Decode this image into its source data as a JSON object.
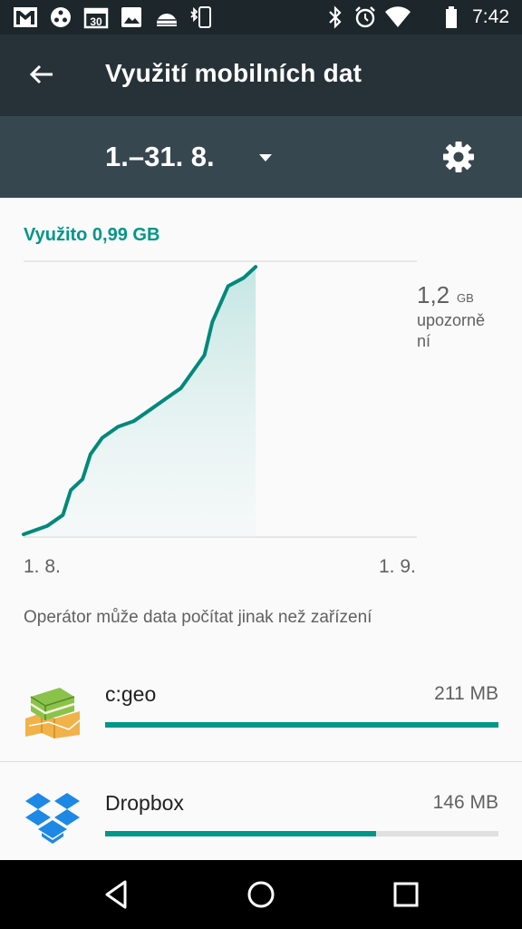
{
  "status_bar": {
    "time": "7:42",
    "calendar_day": "30",
    "left_icons": [
      "gmail-icon",
      "share-icon",
      "calendar-icon",
      "image-icon",
      "android-icon",
      "bluetooth-phone-icon"
    ],
    "right_icons": [
      "bluetooth-icon",
      "alarm-icon",
      "wifi-icon",
      "battery-icon"
    ]
  },
  "app_bar": {
    "title": "Využití mobilních dat",
    "back_icon": "arrow-back-icon"
  },
  "cycle": {
    "label": "1.–31. 8.",
    "dropdown_icon": "dropdown-arrow-icon",
    "settings_icon": "settings-gear-icon"
  },
  "usage": {
    "summary": "Využito 0,99 GB",
    "warning_value": "1,2",
    "warning_unit": "GB",
    "warning_label": "upozorně ní",
    "start_date": "1. 8.",
    "end_date": "1. 9.",
    "carrier_note": "Operátor může data počítat jinak než zařízení"
  },
  "chart_data": {
    "type": "area",
    "x": [
      "1. 8.",
      "1. 9."
    ],
    "ylim": [
      0,
      1.2
    ],
    "points_fraction_of_warning": [
      [
        0.0,
        0.01
      ],
      [
        0.06,
        0.04
      ],
      [
        0.1,
        0.08
      ],
      [
        0.12,
        0.17
      ],
      [
        0.15,
        0.21
      ],
      [
        0.17,
        0.3
      ],
      [
        0.2,
        0.36
      ],
      [
        0.24,
        0.4
      ],
      [
        0.28,
        0.42
      ],
      [
        0.32,
        0.46
      ],
      [
        0.36,
        0.5
      ],
      [
        0.4,
        0.54
      ],
      [
        0.43,
        0.6
      ],
      [
        0.46,
        0.66
      ],
      [
        0.48,
        0.78
      ],
      [
        0.52,
        0.91
      ],
      [
        0.56,
        0.94
      ],
      [
        0.59,
        0.98
      ]
    ],
    "colors": {
      "line": "#00897b",
      "fill": "#b2dfdb"
    }
  },
  "apps": [
    {
      "name": "c:geo",
      "size": "211 MB",
      "fraction": 1.0,
      "icon": "cgeo-app-icon"
    },
    {
      "name": "Dropbox",
      "size": "146 MB",
      "fraction": 0.69,
      "icon": "dropbox-app-icon"
    }
  ],
  "nav": {
    "back_icon": "nav-back-icon",
    "home_icon": "nav-home-icon",
    "recents_icon": "nav-recents-icon"
  },
  "colors": {
    "accent": "#009688",
    "app_bar": "#263238",
    "cycle_bar": "#37474f"
  }
}
